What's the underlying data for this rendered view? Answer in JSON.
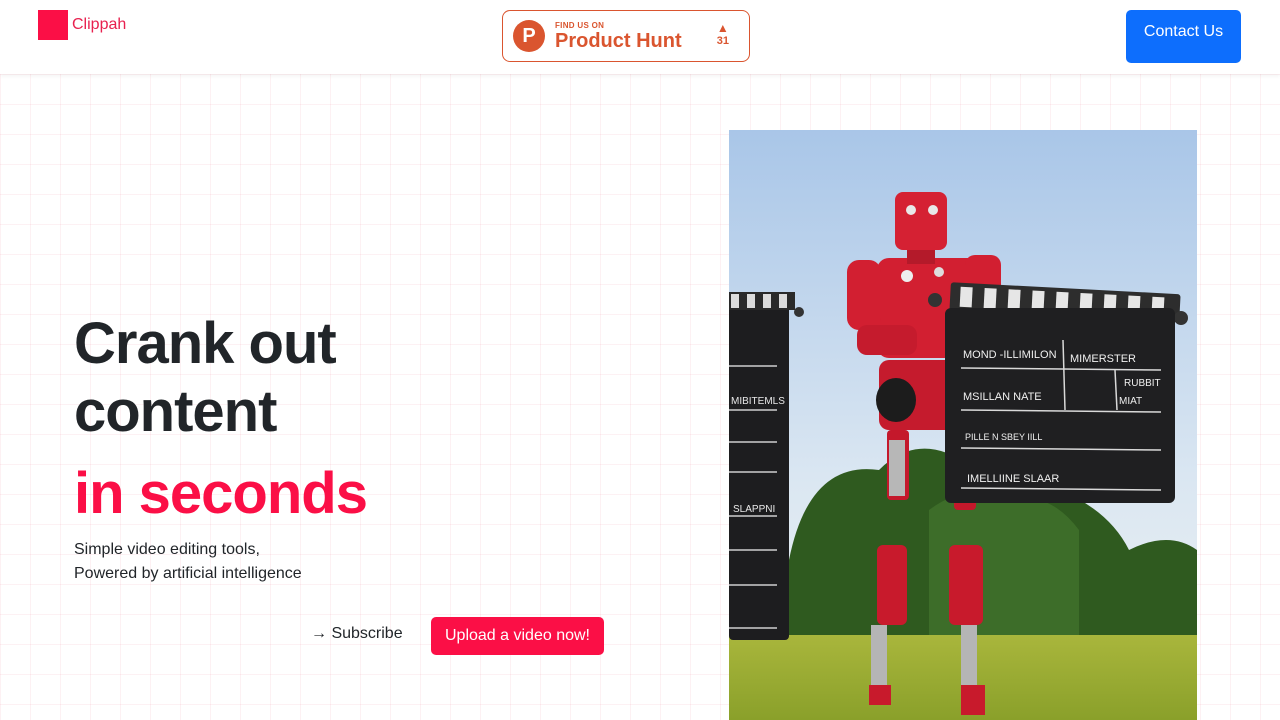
{
  "header": {
    "brand_name": "Clippah",
    "product_hunt": {
      "small_text": "FIND US ON",
      "big_text": "Product Hunt",
      "logo_letter": "P",
      "vote_count": "31"
    },
    "contact_label": "Contact Us"
  },
  "hero": {
    "title_line1": "Crank out",
    "title_line2": "content",
    "title_accent": "in seconds",
    "subtitle_line1": "Simple video editing tools,",
    "subtitle_line2": "Powered by artificial intelligence",
    "subscribe_label": "→ Subscribe",
    "upload_label": "Upload a video now!"
  },
  "image": {
    "board_right": {
      "line1_left": "MOND -ILLIMILON",
      "line1_right": "MIMERSTER",
      "line2_left": "MSILLAN NATE",
      "line2_right_top": "RUBBIT",
      "line2_right_bottom": "MIAT",
      "line3": "PILLE N SBEY IILL",
      "line4": "IMELLIINE  SLAAR"
    },
    "board_left": {
      "line1": "MIBITEMLS",
      "line2": "SLAPPNI"
    }
  },
  "colors": {
    "brand": "#fb0f46",
    "brand_text": "#e8214f",
    "product_hunt": "#da552f",
    "contact_button": "#0d6efd",
    "text": "#212529"
  },
  "icons": {
    "brand_logo": "red-square-icon",
    "product_hunt_logo": "product-hunt-p-icon",
    "upvote": "triangle-up-icon"
  }
}
